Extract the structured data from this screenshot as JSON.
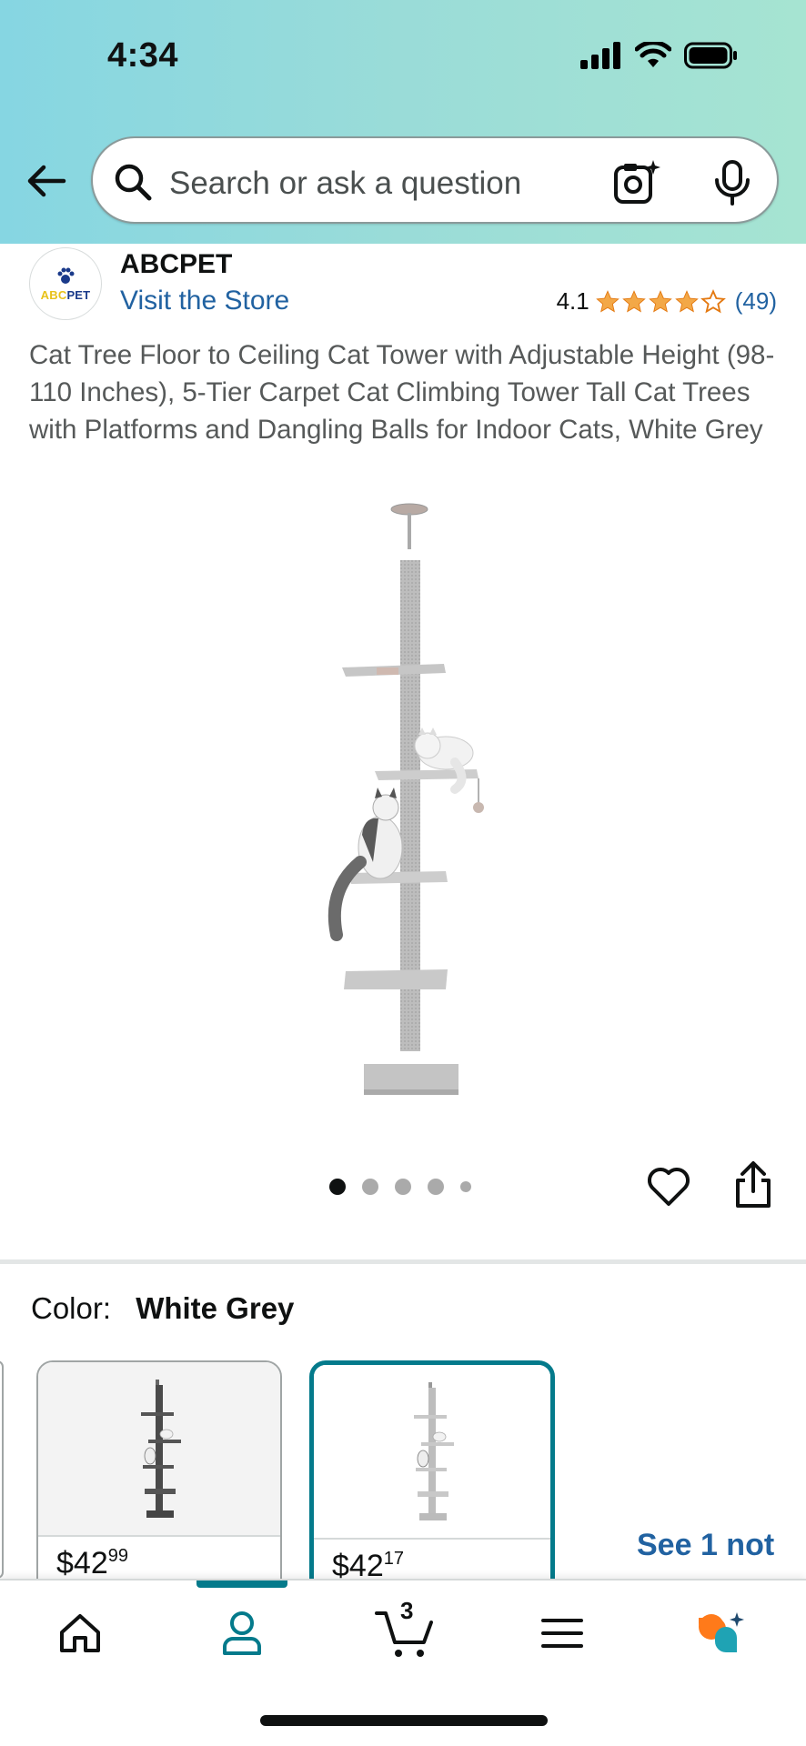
{
  "status_bar": {
    "time": "4:34"
  },
  "search": {
    "placeholder": "Search or ask a question"
  },
  "brand": {
    "name": "ABCPET",
    "logo_text": "ABCPET",
    "store_link": "Visit the Store"
  },
  "rating": {
    "value": "4.1",
    "stars": 4.1,
    "count": "(49)"
  },
  "product": {
    "title": "Cat Tree Floor to Ceiling Cat Tower with Adjustable Height (98-110 Inches), 5-Tier Carpet Cat Climbing Tower Tall Cat Trees with Platforms and Dangling Balls for Indoor Cats, White Grey",
    "image_count": 5,
    "active_image": 1
  },
  "color": {
    "label": "Color:",
    "value": "White Grey"
  },
  "swatches": [
    {
      "price_main": "$42",
      "price_cents": "99",
      "variant": "dark-grey",
      "selected": false
    },
    {
      "price_main": "$42",
      "price_cents": "17",
      "variant": "white-grey",
      "selected": true
    }
  ],
  "see_not_featured": "See 1 not",
  "nav": {
    "items": [
      "home-icon",
      "profile-icon",
      "cart-icon",
      "menu-icon",
      "rufus-icon"
    ],
    "cart_count": "3",
    "active": "profile-icon"
  },
  "colors": {
    "accent": "#047a8b",
    "link": "#2162a1",
    "star": "#f3a847",
    "header_left": "#86d6e2",
    "header_right": "#a6e4d2"
  }
}
